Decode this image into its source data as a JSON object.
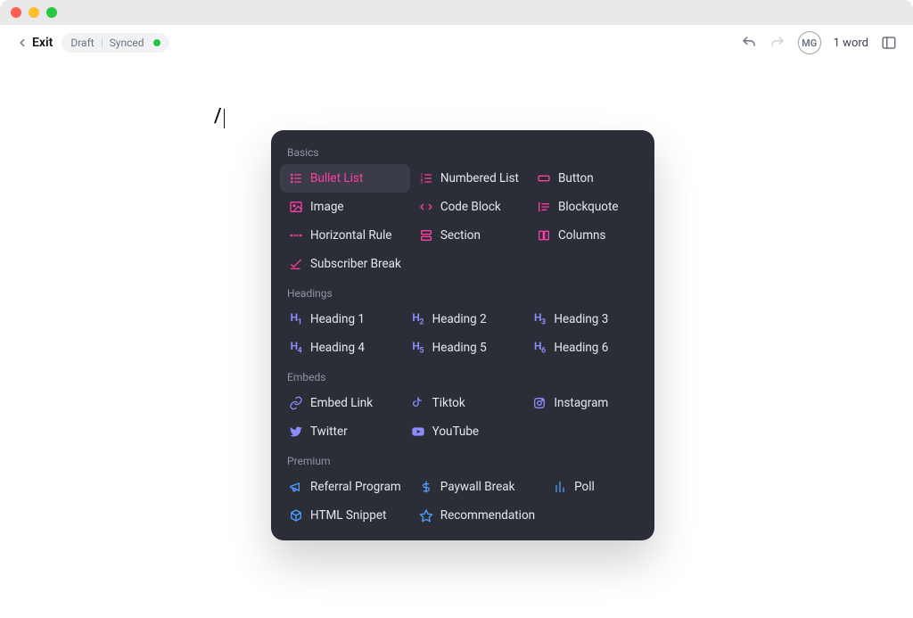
{
  "window": {
    "exit_label": "Exit",
    "draft_label": "Draft",
    "synced_label": "Synced"
  },
  "toolbar": {
    "avatar_initials": "MG",
    "word_count": "1 word"
  },
  "editor": {
    "slash_text": "/"
  },
  "menu": {
    "sections": {
      "basics": {
        "label": "Basics",
        "items": [
          {
            "id": "bullet-list",
            "label": "Bullet List",
            "selected": true
          },
          {
            "id": "numbered-list",
            "label": "Numbered List"
          },
          {
            "id": "button",
            "label": "Button"
          },
          {
            "id": "image",
            "label": "Image"
          },
          {
            "id": "code-block",
            "label": "Code Block"
          },
          {
            "id": "blockquote",
            "label": "Blockquote"
          },
          {
            "id": "horizontal-rule",
            "label": "Horizontal Rule"
          },
          {
            "id": "section",
            "label": "Section"
          },
          {
            "id": "columns",
            "label": "Columns"
          },
          {
            "id": "subscriber-break",
            "label": "Subscriber Break"
          }
        ]
      },
      "headings": {
        "label": "Headings",
        "items": [
          {
            "id": "heading-1",
            "label": "Heading 1",
            "badge": "H1"
          },
          {
            "id": "heading-2",
            "label": "Heading 2",
            "badge": "H2"
          },
          {
            "id": "heading-3",
            "label": "Heading 3",
            "badge": "H3"
          },
          {
            "id": "heading-4",
            "label": "Heading 4",
            "badge": "H4"
          },
          {
            "id": "heading-5",
            "label": "Heading 5",
            "badge": "H5"
          },
          {
            "id": "heading-6",
            "label": "Heading 6",
            "badge": "H6"
          }
        ]
      },
      "embeds": {
        "label": "Embeds",
        "items": [
          {
            "id": "embed-link",
            "label": "Embed Link"
          },
          {
            "id": "tiktok",
            "label": "Tiktok"
          },
          {
            "id": "instagram",
            "label": "Instagram"
          },
          {
            "id": "twitter",
            "label": "Twitter"
          },
          {
            "id": "youtube",
            "label": "YouTube"
          }
        ]
      },
      "premium": {
        "label": "Premium",
        "items": [
          {
            "id": "referral-program",
            "label": "Referral Program"
          },
          {
            "id": "paywall-break",
            "label": "Paywall Break"
          },
          {
            "id": "poll",
            "label": "Poll"
          },
          {
            "id": "html-snippet",
            "label": "HTML Snippet"
          },
          {
            "id": "recommendation",
            "label": "Recommendation"
          }
        ]
      }
    }
  }
}
